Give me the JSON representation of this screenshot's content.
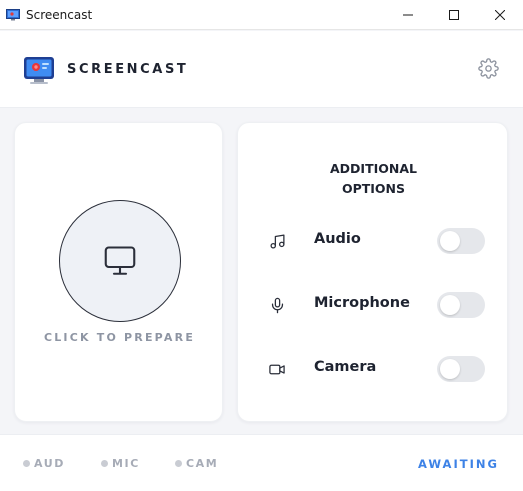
{
  "window": {
    "title": "Screencast",
    "controls": [
      "minimize-icon",
      "maximize-icon",
      "close-icon"
    ]
  },
  "header": {
    "brand": "SCREENCAST",
    "settings_icon": "gear-icon"
  },
  "prepare": {
    "icon": "monitor-icon",
    "label": "CLICK TO PREPARE"
  },
  "options": {
    "title_line1": "ADDITIONAL",
    "title_line2": "OPTIONS",
    "items": [
      {
        "label": "Audio",
        "icon": "music-note-icon",
        "enabled": false
      },
      {
        "label": "Microphone",
        "icon": "microphone-icon",
        "enabled": false
      },
      {
        "label": "Camera",
        "icon": "video-camera-icon",
        "enabled": false
      }
    ]
  },
  "footer": {
    "indicators": [
      {
        "label": "AUD",
        "active": false
      },
      {
        "label": "MIC",
        "active": false
      },
      {
        "label": "CAM",
        "active": false
      }
    ],
    "status": "AWAITING"
  },
  "colors": {
    "accent": "#3d82e6",
    "toggle_off": "#e5e7eb",
    "muted_text": "#a7acb7",
    "indicator_dot": "#c9ccd3"
  }
}
